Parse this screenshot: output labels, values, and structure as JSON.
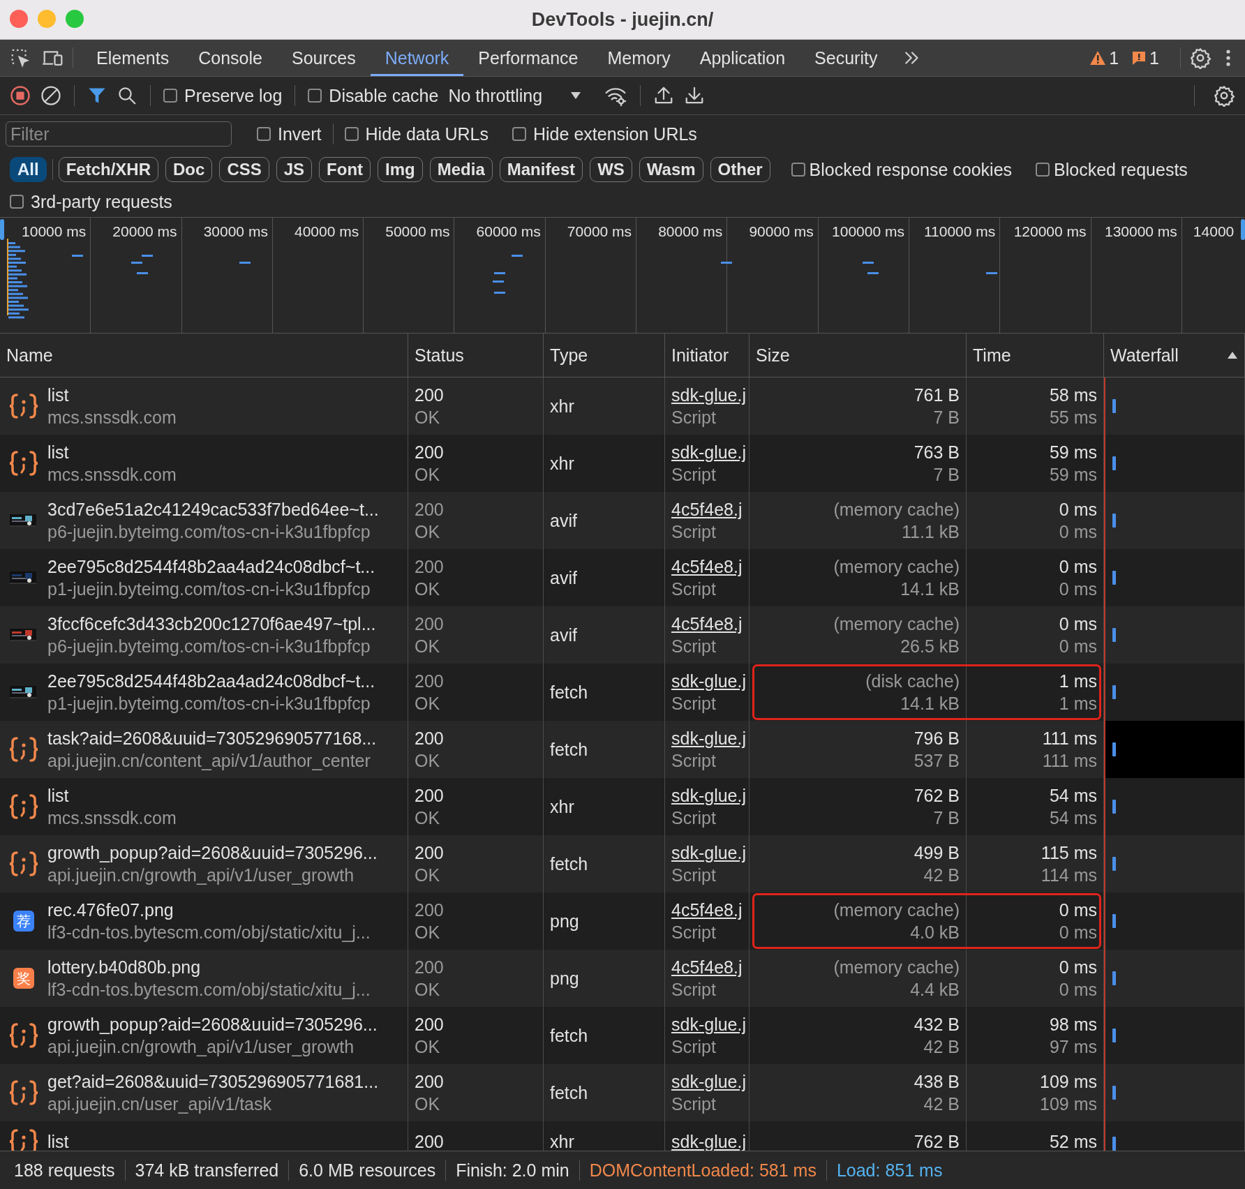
{
  "window": {
    "title": "DevTools - juejin.cn/"
  },
  "tabs": [
    {
      "label": "Elements",
      "selected": false
    },
    {
      "label": "Console",
      "selected": false
    },
    {
      "label": "Sources",
      "selected": false
    },
    {
      "label": "Network",
      "selected": true
    },
    {
      "label": "Performance",
      "selected": false
    },
    {
      "label": "Memory",
      "selected": false
    },
    {
      "label": "Application",
      "selected": false
    },
    {
      "label": "Security",
      "selected": false
    }
  ],
  "issues": {
    "warnings": "1",
    "messages": "1"
  },
  "toolbar": {
    "recording": true,
    "preserve_log": {
      "label": "Preserve log",
      "checked": false
    },
    "disable_cache": {
      "label": "Disable cache",
      "checked": false
    },
    "throttling": "No throttling"
  },
  "filter": {
    "placeholder": "Filter",
    "options": [
      {
        "label": "Invert",
        "checked": false
      },
      {
        "label": "Hide data URLs",
        "checked": false
      },
      {
        "label": "Hide extension URLs",
        "checked": false
      }
    ]
  },
  "type_filters": [
    {
      "label": "All",
      "selected": true
    },
    {
      "label": "Fetch/XHR",
      "selected": false
    },
    {
      "label": "Doc",
      "selected": false
    },
    {
      "label": "CSS",
      "selected": false
    },
    {
      "label": "JS",
      "selected": false
    },
    {
      "label": "Font",
      "selected": false
    },
    {
      "label": "Img",
      "selected": false
    },
    {
      "label": "Media",
      "selected": false
    },
    {
      "label": "Manifest",
      "selected": false
    },
    {
      "label": "WS",
      "selected": false
    },
    {
      "label": "Wasm",
      "selected": false
    },
    {
      "label": "Other",
      "selected": false
    }
  ],
  "blocked_options": [
    {
      "label": "Blocked response cookies",
      "checked": false
    },
    {
      "label": "Blocked requests",
      "checked": false
    }
  ],
  "third_party": {
    "label": "3rd-party requests",
    "checked": false
  },
  "overview_ticks": [
    "10000 ms",
    "20000 ms",
    "30000 ms",
    "40000 ms",
    "50000 ms",
    "60000 ms",
    "70000 ms",
    "80000 ms",
    "90000 ms",
    "100000 ms",
    "110000 ms",
    "120000 ms",
    "130000 ms",
    "14000"
  ],
  "table": {
    "columns": [
      "Name",
      "Status",
      "Type",
      "Initiator",
      "Size",
      "Time",
      "Waterfall"
    ],
    "rows": [
      {
        "kind": "script",
        "name": "list",
        "domain": "mcs.snssdk.com",
        "status": "200",
        "status_text": "OK",
        "type": "xhr",
        "initiator": "sdk-glue.j",
        "initiator_type": "Script",
        "size": "761 B",
        "resource_size": "7 B",
        "time": "58 ms",
        "latency": "55 ms",
        "cached": false,
        "highlighted": false,
        "hovered": false
      },
      {
        "kind": "script",
        "name": "list",
        "domain": "mcs.snssdk.com",
        "status": "200",
        "status_text": "OK",
        "type": "xhr",
        "initiator": "sdk-glue.j",
        "initiator_type": "Script",
        "size": "763 B",
        "resource_size": "7 B",
        "time": "59 ms",
        "latency": "59 ms",
        "cached": false,
        "highlighted": false,
        "hovered": false
      },
      {
        "name": "3cd7e6e51a2c41249cac533f7bed64ee~t...",
        "domain": "p6-juejin.byteimg.com/tos-cn-i-k3u1fbpfcp",
        "status": "200",
        "status_text": "OK",
        "type": "avif",
        "initiator": "4c5f4e8.j",
        "initiator_type": "Script",
        "size": "(memory cache)",
        "resource_size": "11.1 kB",
        "time": "0 ms",
        "latency": "0 ms",
        "cached": true,
        "highlighted": false,
        "hovered": false
      },
      {
        "name": "2ee795c8d2544f48b2aa4ad24c08dbcf~t...",
        "domain": "p1-juejin.byteimg.com/tos-cn-i-k3u1fbpfcp",
        "status": "200",
        "status_text": "OK",
        "type": "avif",
        "initiator": "4c5f4e8.j",
        "initiator_type": "Script",
        "size": "(memory cache)",
        "resource_size": "14.1 kB",
        "time": "0 ms",
        "latency": "0 ms",
        "cached": true,
        "highlighted": false,
        "hovered": false
      },
      {
        "name": "3fccf6cefc3d433cb200c1270f6ae497~tpl...",
        "domain": "p6-juejin.byteimg.com/tos-cn-i-k3u1fbpfcp",
        "status": "200",
        "status_text": "OK",
        "type": "avif",
        "initiator": "4c5f4e8.j",
        "initiator_type": "Script",
        "size": "(memory cache)",
        "resource_size": "26.5 kB",
        "time": "0 ms",
        "latency": "0 ms",
        "cached": true,
        "highlighted": false,
        "hovered": false
      },
      {
        "name": "2ee795c8d2544f48b2aa4ad24c08dbcf~t...",
        "domain": "p1-juejin.byteimg.com/tos-cn-i-k3u1fbpfcp",
        "status": "200",
        "status_text": "OK",
        "type": "fetch",
        "initiator": "sdk-glue.j",
        "initiator_type": "Script",
        "size": "(disk cache)",
        "resource_size": "14.1 kB",
        "time": "1 ms",
        "latency": "1 ms",
        "cached": true,
        "highlighted": true,
        "hovered": false
      },
      {
        "kind": "script",
        "name": "task?aid=2608&uuid=730529690577168...",
        "domain": "api.juejin.cn/content_api/v1/author_center",
        "status": "200",
        "status_text": "OK",
        "type": "fetch",
        "initiator": "sdk-glue.j",
        "initiator_type": "Script",
        "size": "796 B",
        "resource_size": "537 B",
        "time": "111 ms",
        "latency": "111 ms",
        "cached": false,
        "highlighted": false,
        "hovered": true
      },
      {
        "kind": "script",
        "name": "list",
        "domain": "mcs.snssdk.com",
        "status": "200",
        "status_text": "OK",
        "type": "xhr",
        "initiator": "sdk-glue.j",
        "initiator_type": "Script",
        "size": "762 B",
        "resource_size": "7 B",
        "time": "54 ms",
        "latency": "54 ms",
        "cached": false,
        "highlighted": false,
        "hovered": false
      },
      {
        "kind": "script",
        "name": "growth_popup?aid=2608&uuid=7305296...",
        "domain": "api.juejin.cn/growth_api/v1/user_growth",
        "status": "200",
        "status_text": "OK",
        "type": "fetch",
        "initiator": "sdk-glue.j",
        "initiator_type": "Script",
        "size": "499 B",
        "resource_size": "42 B",
        "time": "115 ms",
        "latency": "114 ms",
        "cached": false,
        "highlighted": false,
        "hovered": false
      },
      {
        "kind": "badge",
        "icon_text": "荐",
        "color": "#3b82f6",
        "name": "rec.476fe07.png",
        "domain": "lf3-cdn-tos.bytescm.com/obj/static/xitu_j...",
        "status": "200",
        "status_text": "OK",
        "type": "png",
        "initiator": "4c5f4e8.j",
        "initiator_type": "Script",
        "size": "(memory cache)",
        "resource_size": "4.0 kB",
        "time": "0 ms",
        "latency": "0 ms",
        "cached": true,
        "highlighted": true,
        "hovered": false
      },
      {
        "kind": "badge",
        "icon_text": "奖",
        "color": "#f97f4a",
        "name": "lottery.b40d80b.png",
        "domain": "lf3-cdn-tos.bytescm.com/obj/static/xitu_j...",
        "status": "200",
        "status_text": "OK",
        "type": "png",
        "initiator": "4c5f4e8.j",
        "initiator_type": "Script",
        "size": "(memory cache)",
        "resource_size": "4.4 kB",
        "time": "0 ms",
        "latency": "0 ms",
        "cached": true,
        "highlighted": false,
        "hovered": false
      },
      {
        "kind": "script",
        "name": "growth_popup?aid=2608&uuid=7305296...",
        "domain": "api.juejin.cn/growth_api/v1/user_growth",
        "status": "200",
        "status_text": "OK",
        "type": "fetch",
        "initiator": "sdk-glue.j",
        "initiator_type": "Script",
        "size": "432 B",
        "resource_size": "42 B",
        "time": "98 ms",
        "latency": "97 ms",
        "cached": false,
        "highlighted": false,
        "hovered": false
      },
      {
        "kind": "script",
        "name": "get?aid=2608&uuid=7305296905771681...",
        "domain": "api.juejin.cn/user_api/v1/task",
        "status": "200",
        "status_text": "OK",
        "type": "fetch",
        "initiator": "sdk-glue.j",
        "initiator_type": "Script",
        "size": "438 B",
        "resource_size": "42 B",
        "time": "109 ms",
        "latency": "109 ms",
        "cached": false,
        "highlighted": false,
        "hovered": false
      },
      {
        "kind": "script",
        "name": "list",
        "status": "200",
        "type": "xhr",
        "initiator": "sdk-glue.j",
        "size": "762 B",
        "time": "52 ms",
        "cached": false,
        "highlighted": false,
        "hovered": false
      }
    ]
  },
  "status_bar": [
    {
      "text": "188 requests",
      "color": "#e3e3e3"
    },
    {
      "text": "374 kB transferred",
      "color": "#e3e3e3"
    },
    {
      "text": "6.0 MB resources",
      "color": "#e3e3e3"
    },
    {
      "text": "Finish: 2.0 min",
      "color": "#e3e3e3"
    },
    {
      "text": "DOMContentLoaded: 581 ms",
      "color": "#f2884b"
    },
    {
      "text": "Load: 851 ms",
      "color": "#55b3f0"
    }
  ]
}
